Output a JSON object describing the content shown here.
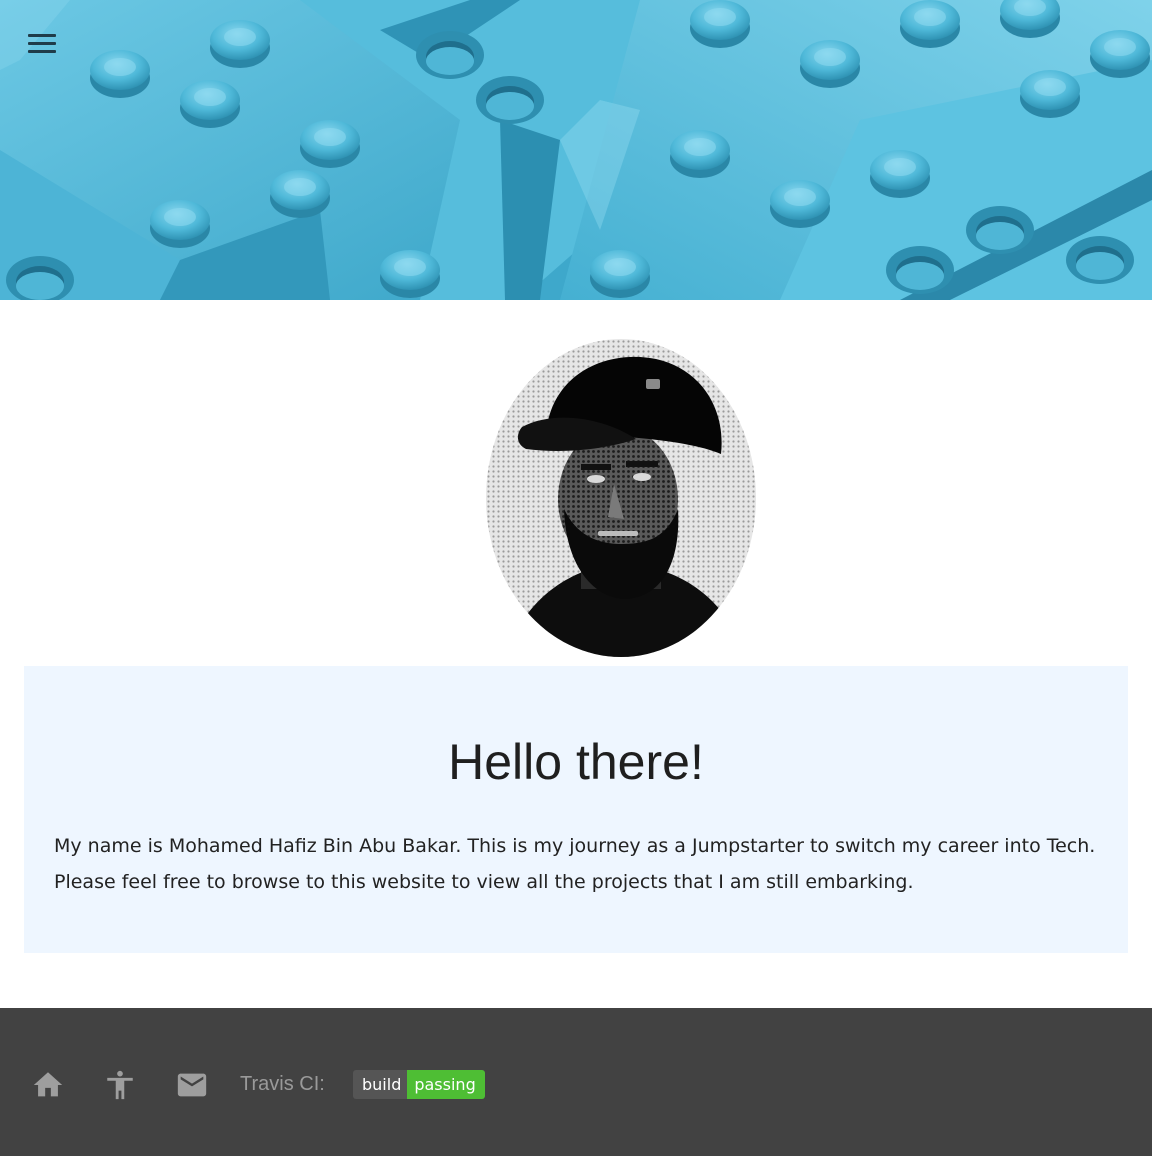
{
  "hero": {
    "menu_icon": "hamburger-menu-icon",
    "image": "light-blue-plastic-bricks-photo"
  },
  "profile": {
    "avatar": "portrait-photo-bearded-man-black-cap"
  },
  "intro": {
    "title": "Hello there!",
    "body": "My name is Mohamed Hafiz Bin Abu Bakar. This is my journey as a Jumpstarter to switch my career into Tech. Please feel free to browse to this website to view all the projects that I am still embarking."
  },
  "footer": {
    "icons": [
      "home-icon",
      "accessibility-icon",
      "mail-icon"
    ],
    "ci_label": "Travis CI:",
    "badge": {
      "left": "build",
      "right": "passing"
    }
  },
  "colors": {
    "hero_blue": "#48b5d6",
    "card_background": "#eef6ff",
    "footer_background": "#424242",
    "badge_passing": "#4ebe34",
    "badge_label": "#555555"
  }
}
